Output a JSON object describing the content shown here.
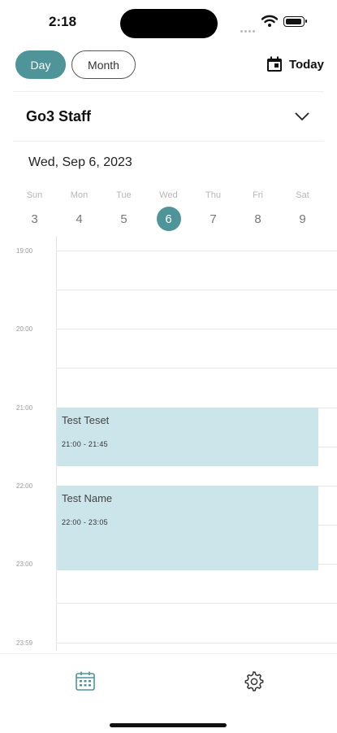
{
  "status": {
    "time": "2:18"
  },
  "toolbar": {
    "day_label": "Day",
    "month_label": "Month",
    "today_label": "Today",
    "active_view": "Day"
  },
  "staff": {
    "name": "Go3 Staff"
  },
  "date": {
    "title": "Wed, Sep 6, 2023"
  },
  "week": [
    {
      "dow": "Sun",
      "day": "3",
      "selected": false
    },
    {
      "dow": "Mon",
      "day": "4",
      "selected": false
    },
    {
      "dow": "Tue",
      "day": "5",
      "selected": false
    },
    {
      "dow": "Wed",
      "day": "6",
      "selected": true
    },
    {
      "dow": "Thu",
      "day": "7",
      "selected": false
    },
    {
      "dow": "Fri",
      "day": "8",
      "selected": false
    },
    {
      "dow": "Sat",
      "day": "9",
      "selected": false
    }
  ],
  "timeline": {
    "hours": [
      "19:00",
      "20:00",
      "21:00",
      "22:00",
      "23:00",
      "23:59"
    ],
    "events": [
      {
        "title": "Test Teset",
        "time": "21:00 - 21:45"
      },
      {
        "title": "Test Name",
        "time": "22:00 - 23:05"
      }
    ]
  },
  "colors": {
    "accent": "#4f9499",
    "event_bg": "#cce5ea"
  },
  "tabs": [
    {
      "icon": "calendar-icon",
      "active": true
    },
    {
      "icon": "gear-icon",
      "active": false
    }
  ]
}
